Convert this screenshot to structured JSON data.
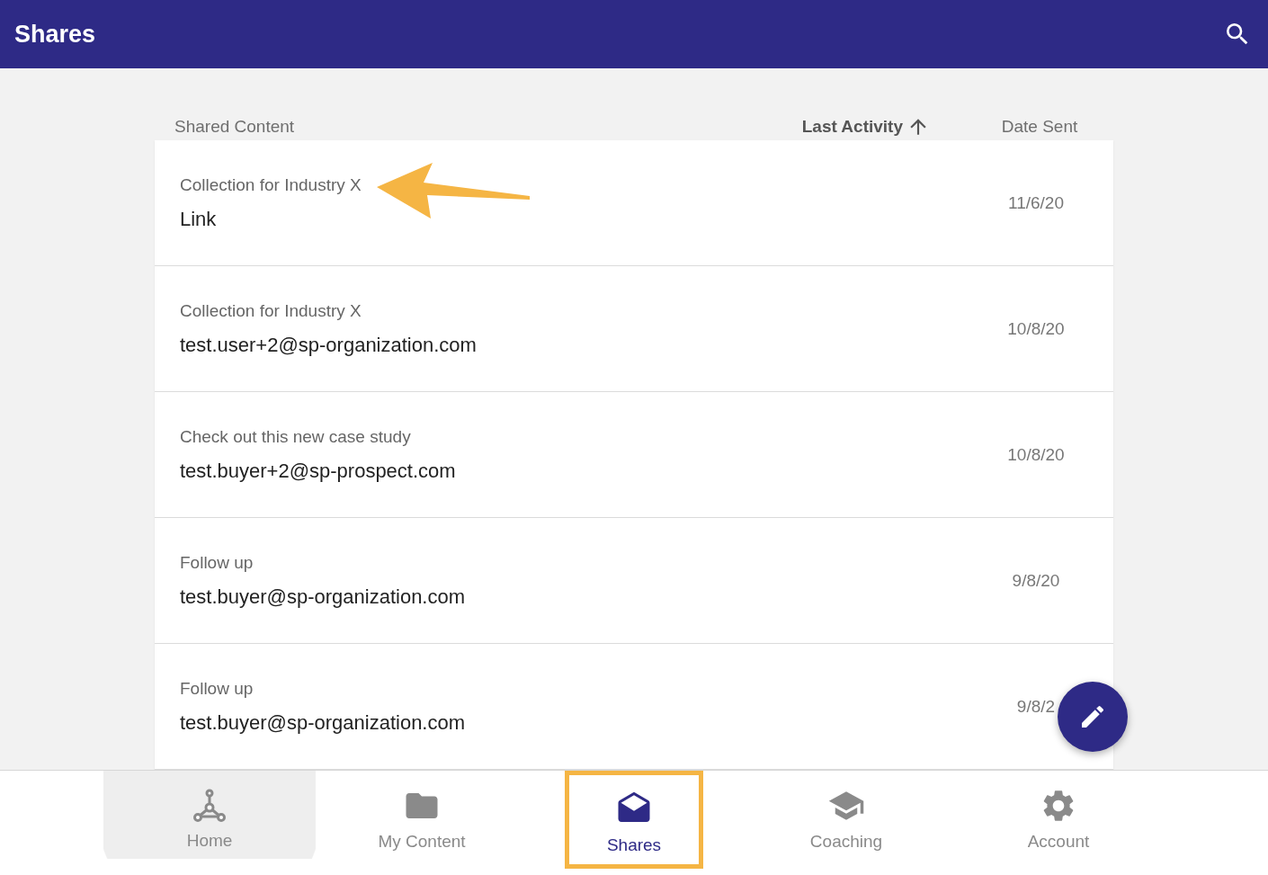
{
  "app_bar": {
    "title": "Shares"
  },
  "table": {
    "columns": [
      {
        "label": "Shared Content",
        "sorted": false
      },
      {
        "label": "Last Activity",
        "sorted": true
      },
      {
        "label": "Date Sent",
        "sorted": false
      }
    ],
    "rows": [
      {
        "title": "Collection for Industry X",
        "recipient": "Link",
        "date": "11/6/20",
        "annotated": true
      },
      {
        "title": "Collection for Industry X",
        "recipient": "test.user+2@sp-organization.com",
        "date": "10/8/20",
        "annotated": false
      },
      {
        "title": "Check out this new case study",
        "recipient": "test.buyer+2@sp-prospect.com",
        "date": "10/8/20",
        "annotated": false
      },
      {
        "title": "Follow up",
        "recipient": "test.buyer@sp-organization.com",
        "date": "9/8/20",
        "annotated": false
      },
      {
        "title": "Follow up",
        "recipient": "test.buyer@sp-organization.com",
        "date": "9/8/2",
        "annotated": false
      }
    ]
  },
  "nav": [
    {
      "kind": "home",
      "label": "Home",
      "selected": false,
      "pressed": true,
      "highlighted": false
    },
    {
      "kind": "content",
      "label": "My Content",
      "selected": false,
      "pressed": false,
      "highlighted": false
    },
    {
      "kind": "shares",
      "label": "Shares",
      "selected": true,
      "pressed": false,
      "highlighted": true
    },
    {
      "kind": "coaching",
      "label": "Coaching",
      "selected": false,
      "pressed": false,
      "highlighted": false
    },
    {
      "kind": "account",
      "label": "Account",
      "selected": false,
      "pressed": false,
      "highlighted": false
    }
  ]
}
